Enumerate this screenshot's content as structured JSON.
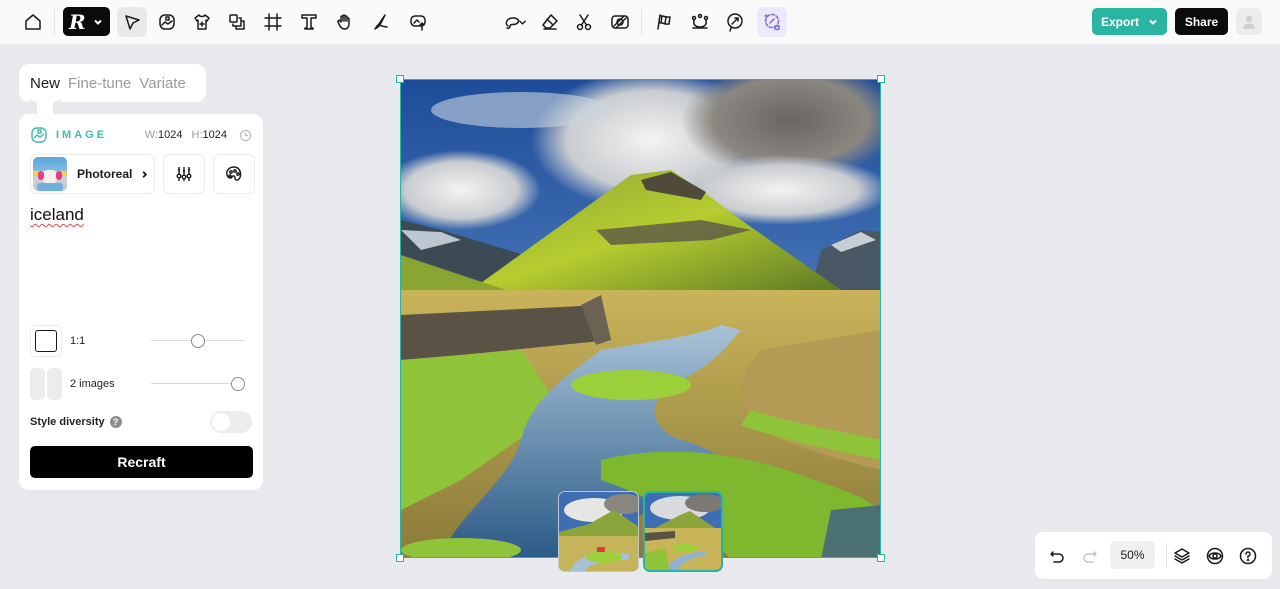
{
  "toolbar": {
    "left_icons": [
      "home-icon",
      "app-logo",
      "select-pointer-icon",
      "image-generate-icon",
      "mockup-shirt-icon",
      "layers-stack-icon",
      "frame-crop-icon",
      "text-tool-icon",
      "hand-pan-icon",
      "brush-draw-icon",
      "upload-image-icon"
    ],
    "middle_icons": [
      "lasso-select-icon",
      "eraser-icon",
      "scissors-cut-icon",
      "pattern-icon",
      "flag-checkered-icon",
      "vector-nodes-icon",
      "resize-arrow-icon",
      "ai-magic-icon"
    ],
    "logo_letter": "R",
    "export_label": "Export",
    "share_label": "Share"
  },
  "mode_tabs": [
    {
      "label": "New",
      "active": true
    },
    {
      "label": "Fine-tune",
      "active": false
    },
    {
      "label": "Variate",
      "active": false
    }
  ],
  "panel": {
    "type_label": "IMAGE",
    "width_label": "W:",
    "width_value": "1024",
    "height_label": "H:",
    "height_value": "1024",
    "style_name": "Photoreal",
    "prompt": "iceland",
    "aspect_ratio": "1:1",
    "aspect_slider_fraction": 0.5,
    "image_count_label": "2 images",
    "image_count_slider_fraction": 1.0,
    "style_diversity_label": "Style diversity",
    "help_glyph": "?",
    "style_diversity_enabled": false,
    "generate_label": "Recraft"
  },
  "canvas": {
    "accent_color": "#2ab5a2",
    "thumbnails": [
      {
        "name": "variant-1",
        "selected": false
      },
      {
        "name": "variant-2",
        "selected": true
      }
    ]
  },
  "bottom_controls": {
    "zoom_level": "50%",
    "undo_enabled": true,
    "redo_enabled": false
  }
}
